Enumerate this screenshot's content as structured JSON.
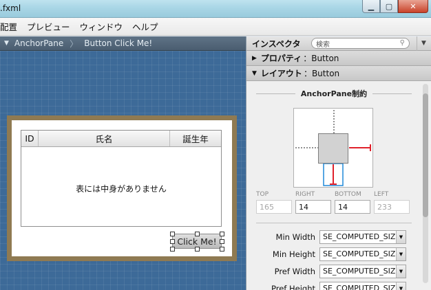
{
  "window": {
    "title": ".fxml"
  },
  "menu": {
    "items": [
      "配置",
      "プレビュー",
      "ウィンドウ",
      "ヘルプ"
    ]
  },
  "breadcrumb": {
    "items": [
      "AnchorPane",
      "Button Click Me!"
    ]
  },
  "table": {
    "columns": [
      "ID",
      "氏名",
      "誕生年"
    ],
    "placeholder": "表には中身がありません"
  },
  "button": {
    "label": "Click Me!"
  },
  "inspector": {
    "title": "インスペクタ",
    "search_placeholder": "検索",
    "properties_section": "プロパティ",
    "properties_target": "Button",
    "layout_section": "レイアウト",
    "layout_target": "Button",
    "anchor_title": "AnchorPane制約",
    "anchors": [
      {
        "label": "TOP",
        "value": "165",
        "enabled": false
      },
      {
        "label": "RIGHT",
        "value": "14",
        "enabled": true
      },
      {
        "label": "BOTTOM",
        "value": "14",
        "enabled": true
      },
      {
        "label": "LEFT",
        "value": "233",
        "enabled": false
      }
    ],
    "props": [
      {
        "label": "Min Width",
        "value": "SE_COMPUTED_SIZE"
      },
      {
        "label": "Min Height",
        "value": "SE_COMPUTED_SIZE"
      },
      {
        "label": "Pref Width",
        "value": "SE_COMPUTED_SIZE"
      },
      {
        "label": "Pref Height",
        "value": "SE_COMPUTED_SIZE"
      }
    ]
  },
  "colors": {
    "canvas": "#3d6a98",
    "anchor_active": "#e0202a",
    "anchor_selected": "#1e88d8"
  }
}
